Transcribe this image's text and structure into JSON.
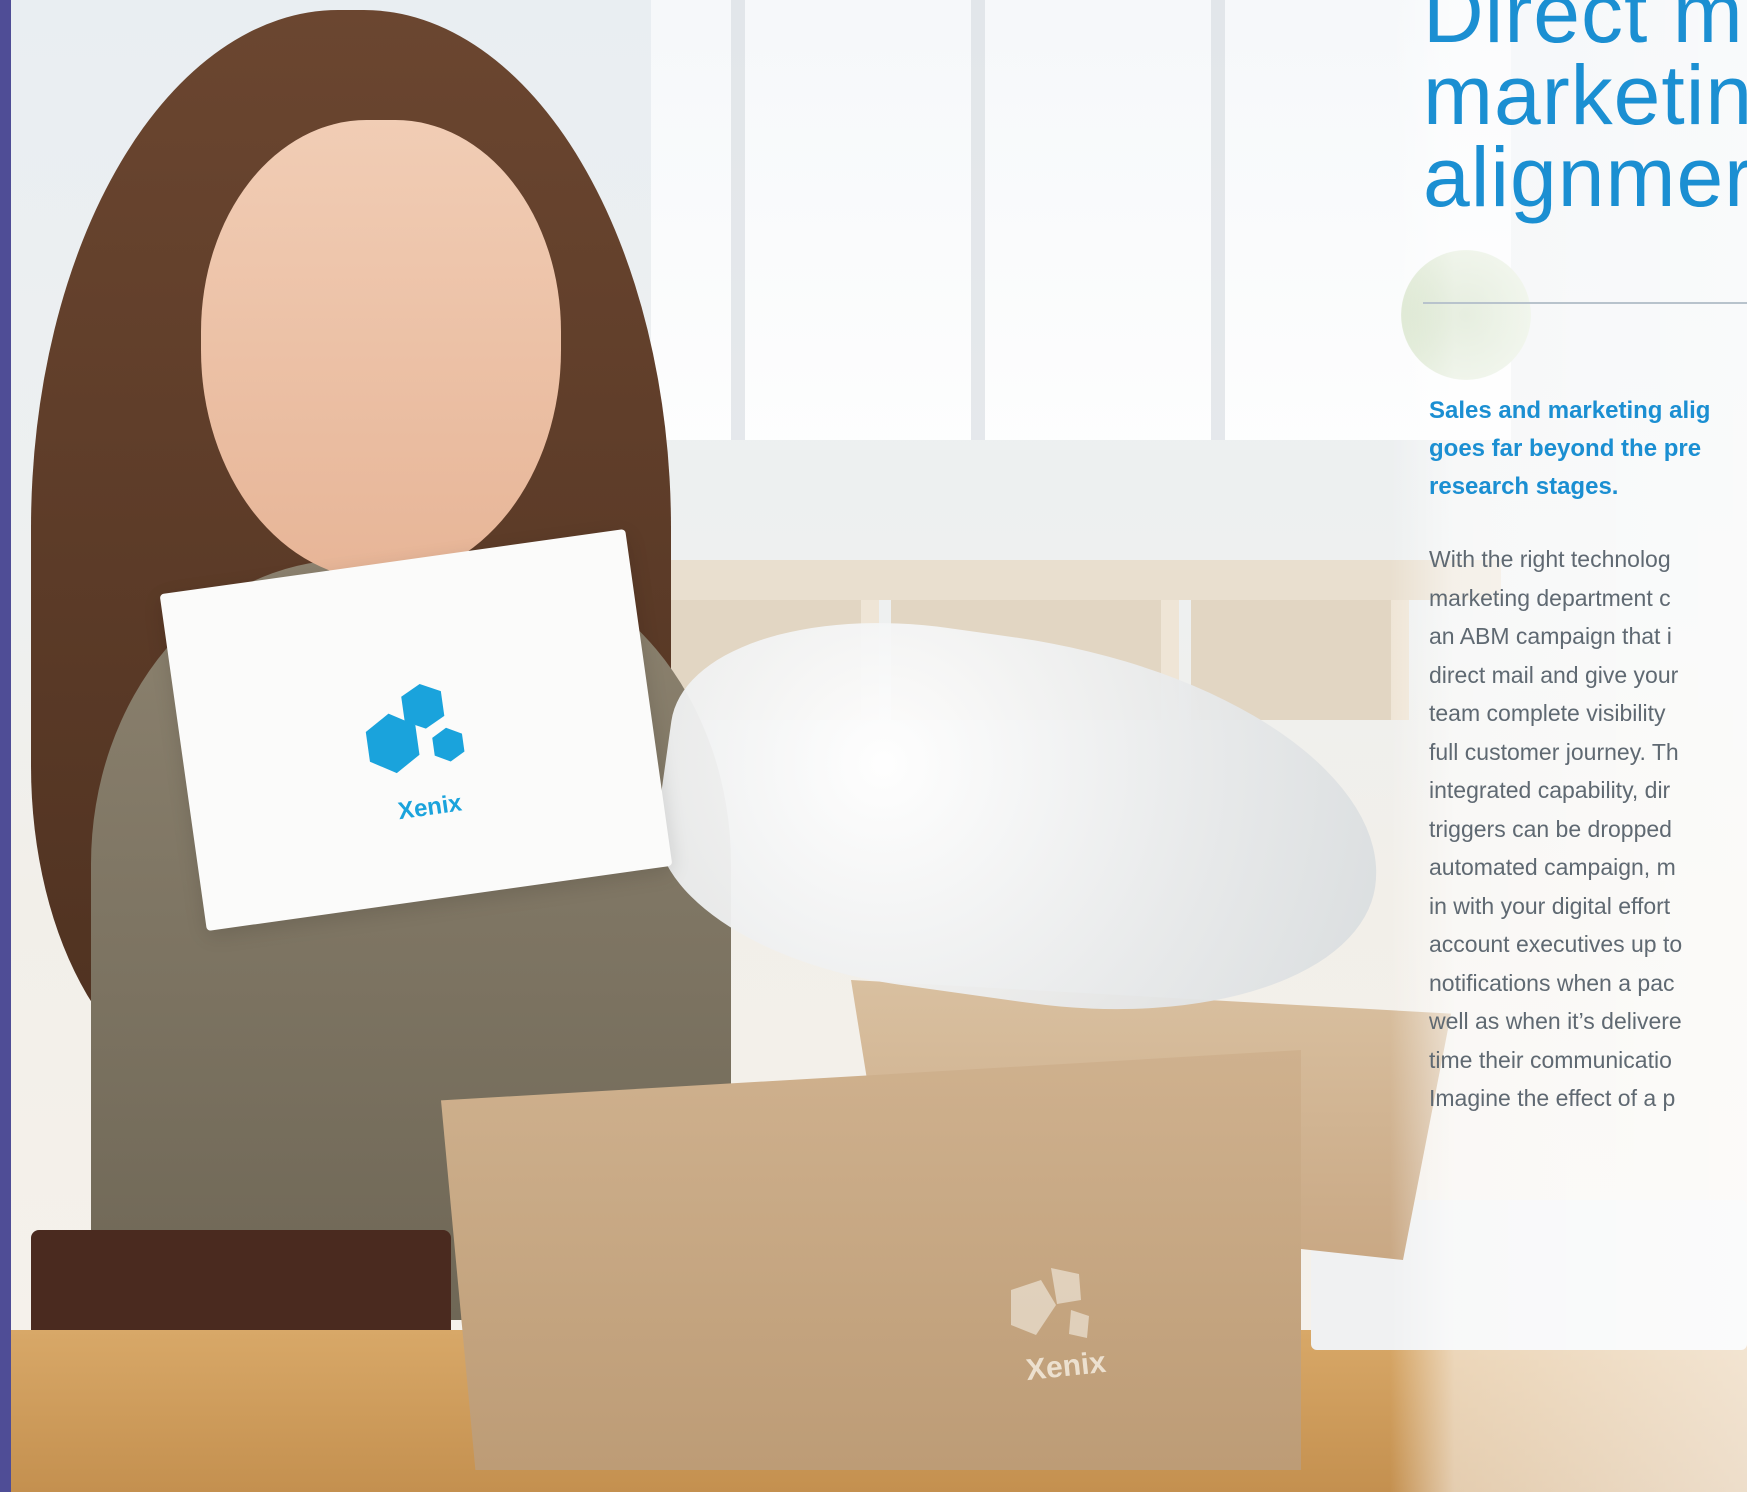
{
  "colors": {
    "accent": "#1b8fd2",
    "body_text": "#5f6972",
    "side_strip": "#4f4d96",
    "logo_blue": "#1aa3dc"
  },
  "heading": {
    "lines": [
      "Direct m",
      "marketin",
      "alignmer"
    ]
  },
  "lead": {
    "lines": [
      "Sales and marketing alig",
      "goes far beyond the pre",
      "research stages."
    ]
  },
  "body": {
    "lines": [
      "With the right technolog",
      "marketing department c",
      "an ABM campaign that i",
      "direct mail and give your",
      "team complete visibility",
      "full customer journey. Th",
      "integrated capability, dir",
      "triggers can be dropped",
      "automated campaign, m",
      "in with your digital effort",
      "account executives up to",
      "notifications when a pac",
      "well as when it’s delivere",
      "time their communicatio",
      "Imagine the effect of a p"
    ]
  },
  "photo": {
    "product_box_label": "Xenix",
    "carton_label": "Xenix",
    "logo_icon": "hexagon-cluster-icon"
  }
}
